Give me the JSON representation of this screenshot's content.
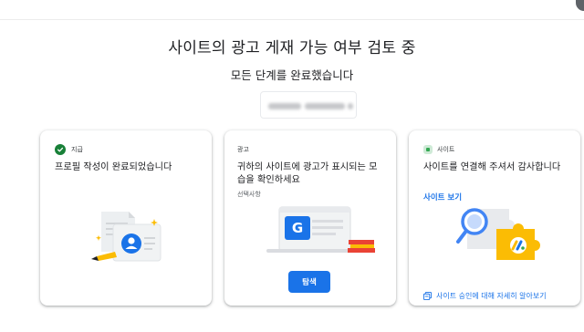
{
  "header": {
    "title": "사이트의 광고 게재 가능 여부 검토 중",
    "subtitle": "모든 단계를 완료했습니다"
  },
  "colors": {
    "accent": "#1a73e8",
    "success": "#188038",
    "badge": "#ceead6"
  },
  "cards": [
    {
      "status": "지급",
      "status_icon": "check-circle-icon",
      "title": "프로필 작성이 완료되었습니다"
    },
    {
      "status": "광고",
      "title": "귀하의 사이트에 광고가 표시되는 모습을 확인하세요",
      "note": "선택사항",
      "button_label": "탐색"
    },
    {
      "status": "사이트",
      "status_icon": "site-square-icon",
      "title": "사이트를 연결해 주셔서 감사합니다",
      "link_label": "사이트 보기",
      "footer_icon": "document-icon",
      "footer_link": "사이트 승인에 대해 자세히 알아보기"
    }
  ]
}
